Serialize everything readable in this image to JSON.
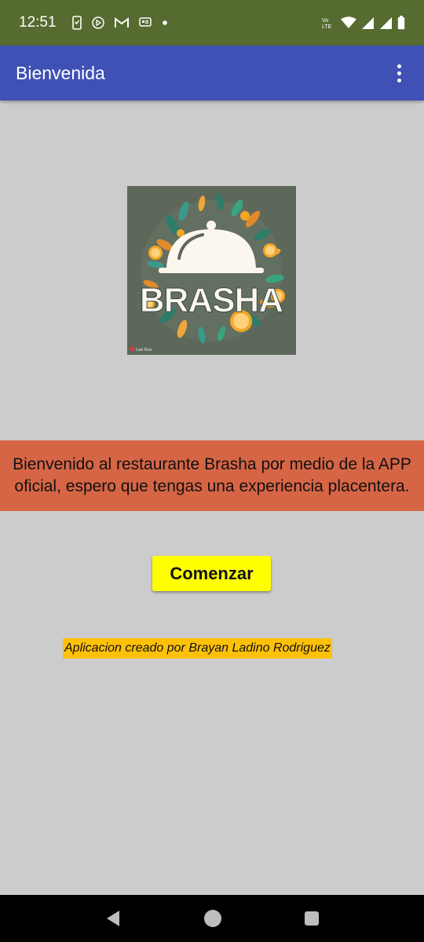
{
  "status_bar": {
    "time": "12:51",
    "notification_icons": [
      "phone-icon",
      "play-icon",
      "gmail-icon",
      "message-icon",
      "dot-icon"
    ],
    "system_icons": [
      "volte-icon",
      "wifi-icon",
      "signal-icon",
      "signal-icon",
      "battery-icon"
    ],
    "volte_label": "Vo LTE"
  },
  "app_bar": {
    "title": "Bienvenida",
    "menu_icon": "more-vert-icon",
    "color": "#3f51b5"
  },
  "logo": {
    "text": "BRASHA",
    "watermark": "Luis Ruiz"
  },
  "welcome": {
    "message": "Bienvenido al restaurante Brasha por medio de la APP oficial, espero que tengas una experiencia placentera.",
    "color": "#d66546"
  },
  "start_button": {
    "label": "Comenzar",
    "color": "#ffff00"
  },
  "credit": {
    "text": "Aplicacion creado por Brayan Ladino Rodriguez",
    "color": "#ffc107"
  },
  "nav_bar": {
    "icons": [
      "back-icon",
      "home-icon",
      "recents-icon"
    ]
  }
}
